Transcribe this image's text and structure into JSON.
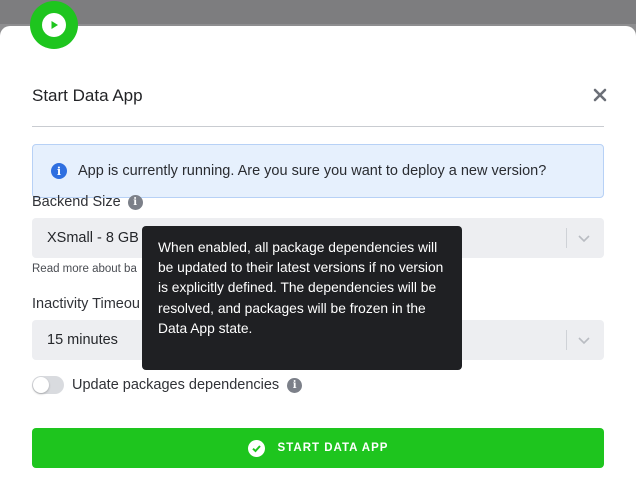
{
  "modal": {
    "title": "Start Data App",
    "close_icon": "close-icon",
    "badge_icon": "play-icon",
    "accent_color": "#1ec51e"
  },
  "alert": {
    "icon": "info-icon",
    "text": "App is currently running. Are you sure you want to deploy a new version?"
  },
  "backend_size": {
    "label": "Backend Size",
    "value": "XSmall - 8 GB",
    "hint": "Read more about ba"
  },
  "inactivity_timeout": {
    "label": "Inactivity Timeou",
    "value": "15 minutes"
  },
  "update_dependencies": {
    "label": "Update packages dependencies",
    "enabled": false
  },
  "tooltip": {
    "text": "When enabled, all package dependencies will be updated to their latest versions if no version is explicitly defined. The dependencies will be resolved, and packages will be frozen in the Data App state."
  },
  "primary_button": {
    "label": "START DATA APP",
    "icon": "check-circle-icon"
  }
}
